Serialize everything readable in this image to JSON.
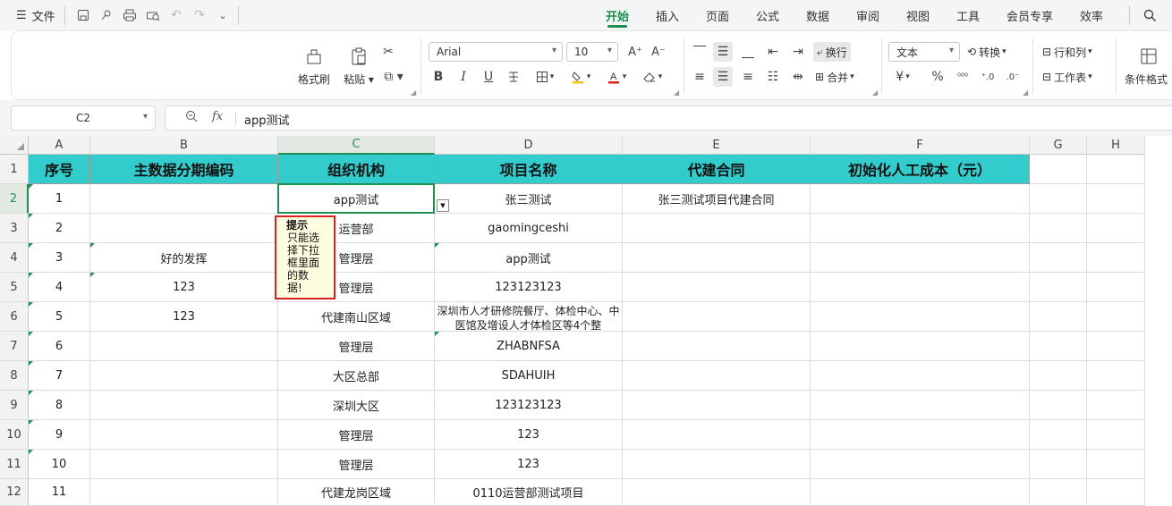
{
  "menubar": {
    "file_label": "文件",
    "tabs": [
      "开始",
      "插入",
      "页面",
      "公式",
      "数据",
      "审阅",
      "视图",
      "工具",
      "会员专享",
      "效率"
    ],
    "active_tab": "开始"
  },
  "ribbon": {
    "format_painter": "格式刷",
    "paste": "粘贴",
    "font_name": "Arial",
    "font_size": "10",
    "wrap_text": "换行",
    "merge": "合并",
    "number_format": "文本",
    "convert": "转换",
    "rows_cols": "行和列",
    "worksheet": "工作表",
    "cond_format": "条件格式"
  },
  "formula_bar": {
    "name_box": "C2",
    "fx_label": "fx",
    "value": "app测试"
  },
  "columns": [
    "A",
    "B",
    "C",
    "D",
    "E",
    "F",
    "G",
    "H"
  ],
  "rows": [
    "1",
    "2",
    "3",
    "4",
    "5",
    "6",
    "7",
    "8",
    "9",
    "10",
    "11",
    "12"
  ],
  "header_row": [
    "序号",
    "主数据分期编码",
    "组织机构",
    "项目名称",
    "代建合同",
    "初始化人工成本（元）"
  ],
  "data_rows": [
    [
      "1",
      "",
      "app测试",
      "张三测试",
      "张三测试项目代建合同",
      ""
    ],
    [
      "2",
      "",
      "运营部",
      "gaomingceshi",
      "",
      ""
    ],
    [
      "3",
      "好的发挥",
      "管理层",
      "app测试",
      "",
      ""
    ],
    [
      "4",
      "123",
      "管理层",
      "123123123",
      "",
      ""
    ],
    [
      "5",
      "123",
      "代建南山区域",
      "深圳市人才研修院餐厅、体检中心、中医馆及增设人才体检区等4个整",
      "",
      ""
    ],
    [
      "6",
      "",
      "管理层",
      "ZHABNFSA",
      "",
      ""
    ],
    [
      "7",
      "",
      "大区总部",
      "SDAHUIH",
      "",
      ""
    ],
    [
      "8",
      "",
      "深圳大区",
      "123123123",
      "",
      ""
    ],
    [
      "9",
      "",
      "管理层",
      "123",
      "",
      ""
    ],
    [
      "10",
      "",
      "管理层",
      "123",
      "",
      ""
    ],
    [
      "11",
      "",
      "代建龙岗区域",
      "0110运营部测试项目",
      "",
      ""
    ]
  ],
  "tooltip": {
    "title": "提示",
    "lines": [
      "只能选",
      "择下拉",
      "框里面",
      "的数",
      "据!"
    ]
  },
  "colors": {
    "header_fill": "#33cccc",
    "accent": "#1e8f4e",
    "tooltip_border": "#dd2222"
  }
}
